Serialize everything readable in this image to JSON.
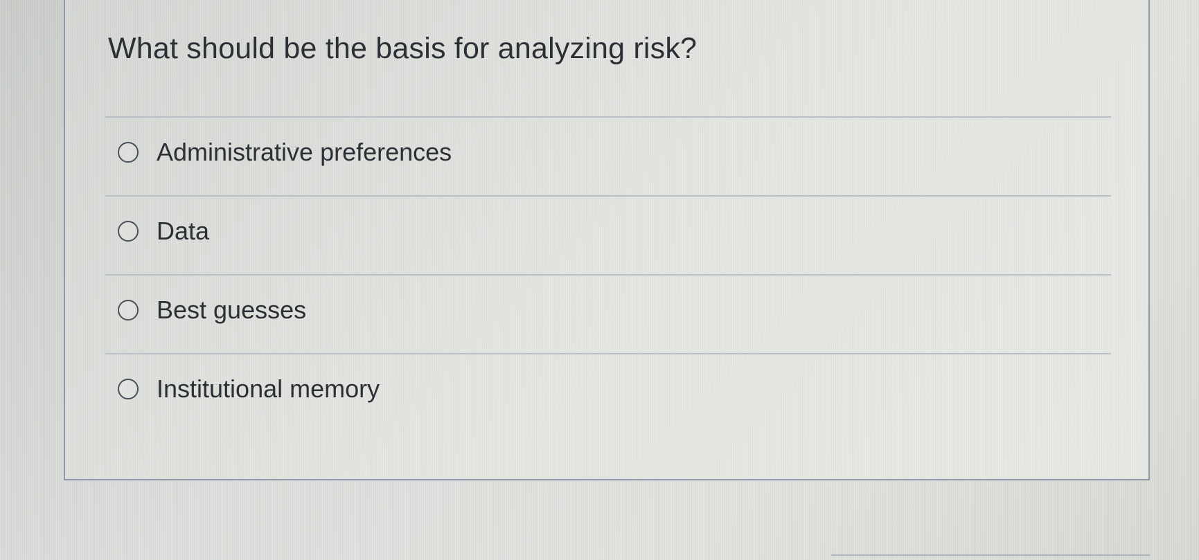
{
  "question": {
    "text": "What should be the basis for analyzing risk?"
  },
  "options": [
    {
      "label": "Administrative preferences",
      "selected": false
    },
    {
      "label": "Data",
      "selected": false
    },
    {
      "label": "Best guesses",
      "selected": false
    },
    {
      "label": "Institutional memory",
      "selected": false
    }
  ],
  "icons": {
    "radio": "radio-unselected-icon"
  },
  "colors": {
    "text": "#2d2f36",
    "border": "#8f97a8",
    "divider": "#b9bfc6"
  }
}
